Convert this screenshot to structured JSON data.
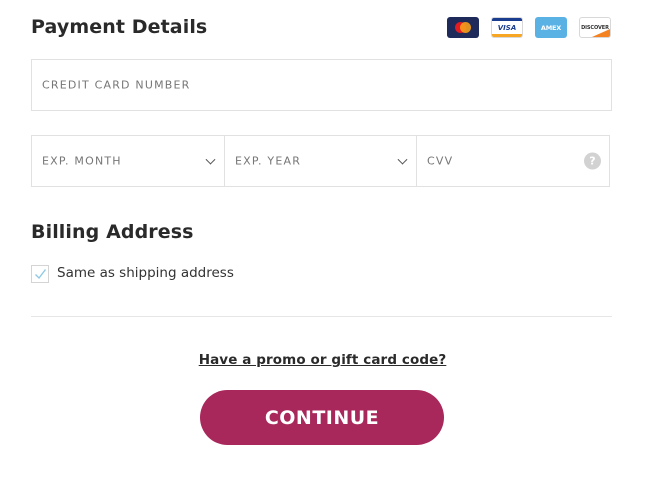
{
  "payment": {
    "title": "Payment Details",
    "cards": [
      {
        "name": "mastercard-icon",
        "label": ""
      },
      {
        "name": "visa-icon",
        "label": "VISA"
      },
      {
        "name": "amex-icon",
        "label": "AMEX"
      },
      {
        "name": "discover-icon",
        "label": "DISCOVER"
      }
    ],
    "card_number_placeholder": "CREDIT CARD NUMBER",
    "exp_month_placeholder": "EXP. MONTH",
    "exp_year_placeholder": "EXP. YEAR",
    "cvv_placeholder": "CVV",
    "cvv_help": "?"
  },
  "billing": {
    "title": "Billing Address",
    "same_as_shipping_label": "Same as shipping address",
    "same_as_shipping_checked": true
  },
  "promo_link": "Have a promo or gift card code?",
  "continue_label": "CONTINUE",
  "colors": {
    "accent": "#a8285c",
    "border": "#e1e1e1",
    "placeholder": "#767676"
  }
}
